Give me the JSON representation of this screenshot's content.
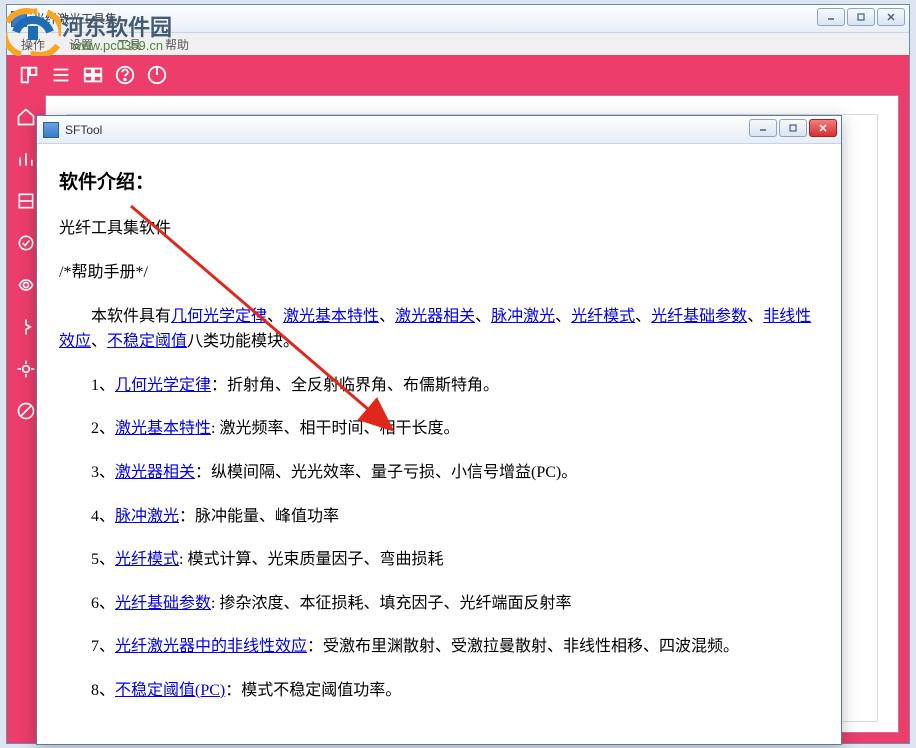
{
  "watermark": {
    "text": "河东软件园",
    "url": "www.pc0359.cn"
  },
  "outerWindow": {
    "title": "光纤激光工具集"
  },
  "menubar": {
    "items": [
      "操作",
      "设置",
      "工具",
      "帮助"
    ]
  },
  "dialog": {
    "title": "SFTool"
  },
  "doc": {
    "heading": "软件介绍：",
    "subtitle": "光纤工具集软件",
    "note": "/*帮助手册*/",
    "intro_prefix": "本软件具有",
    "intro_links": [
      "几何光学定律",
      "激光基本特性",
      "激光器相关",
      "脉冲激光",
      "光纤模式",
      "光纤基础参数",
      "非线性效应",
      "不稳定阈值"
    ],
    "intro_suffix": "八类功能模块。",
    "list": [
      {
        "n": "1、",
        "link": "几何光学定律",
        "rest": "：折射角、全反射临界角、布儒斯特角。"
      },
      {
        "n": "2、",
        "link": "激光基本特性",
        "rest": ": 激光频率、相干时间、相干长度。"
      },
      {
        "n": "3、",
        "link": "激光器相关",
        "rest": "：纵模间隔、光光效率、量子亏损、小信号增益(PC)。"
      },
      {
        "n": "4、",
        "link": "脉冲激光",
        "rest": "：脉冲能量、峰值功率"
      },
      {
        "n": "5、",
        "link": "光纤模式",
        "rest": ": 模式计算、光束质量因子、弯曲损耗"
      },
      {
        "n": "6、",
        "link": "光纤基础参数",
        "rest": ": 掺杂浓度、本征损耗、填充因子、光纤端面反射率"
      },
      {
        "n": "7、",
        "link": "光纤激光器中的非线性效应",
        "rest": "：受激布里渊散射、受激拉曼散射、非线性相移、四波混频。"
      },
      {
        "n": "8、",
        "link": "不稳定阈值(PC)",
        "rest": "：模式不稳定阈值功率。"
      }
    ]
  }
}
